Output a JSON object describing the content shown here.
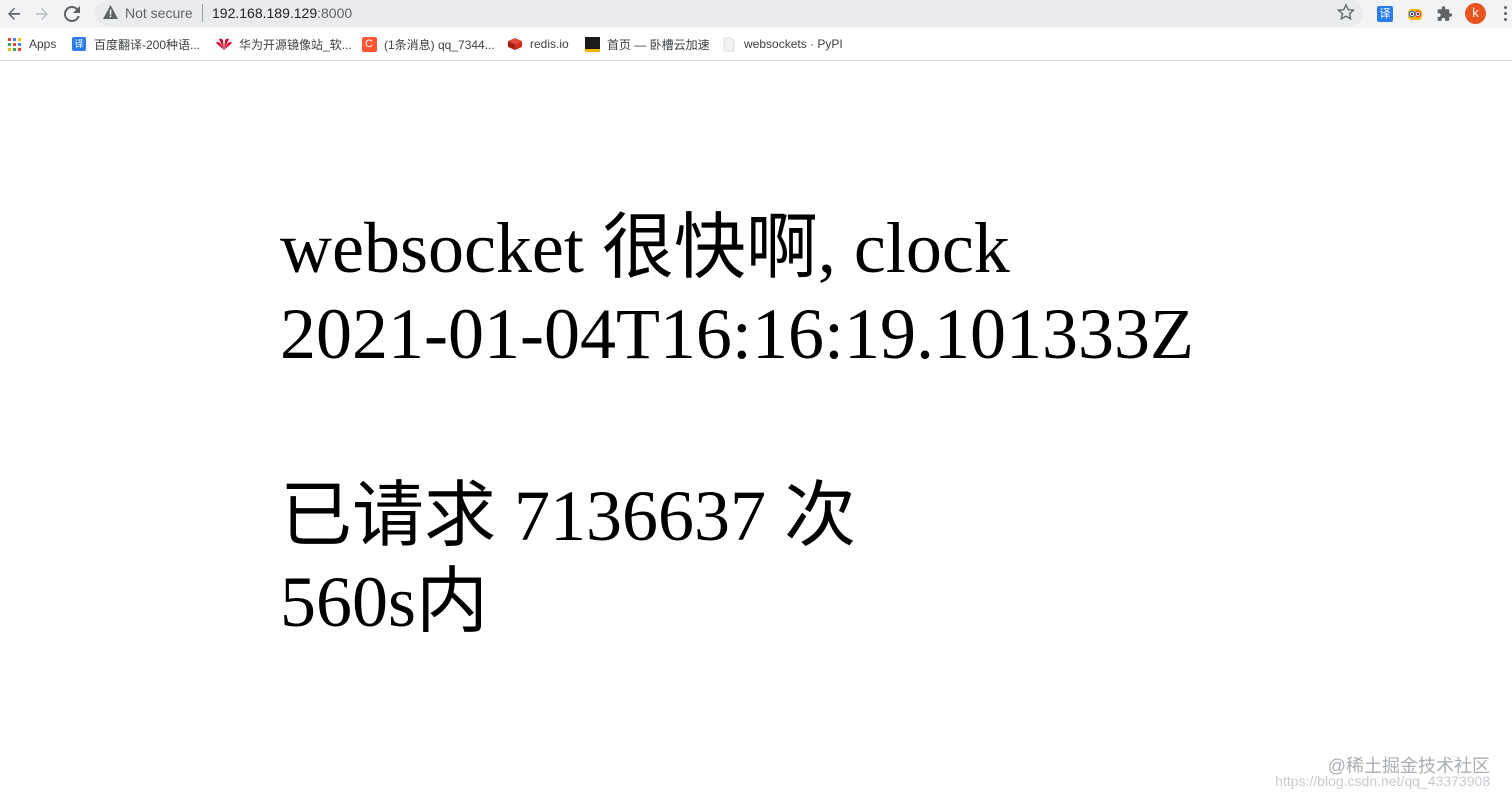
{
  "browser": {
    "address_bar": {
      "security_label": "Not secure",
      "host": "192.168.189.129",
      "port": ":8000"
    },
    "profile_initial": "k",
    "translate_ext_label": "译",
    "bookmarks": [
      {
        "label": "Apps",
        "icon": "apps-grid-icon",
        "color": "#4285f4"
      },
      {
        "label": "百度翻译-200种语...",
        "icon": "baidu-translate-icon",
        "color": "#2b7de9"
      },
      {
        "label": "华为开源镜像站_软...",
        "icon": "huawei-icon",
        "color": "#cf0a2c"
      },
      {
        "label": "(1条消息) qq_7344...",
        "icon": "csdn-icon",
        "color": "#fc5531"
      },
      {
        "label": "redis.io",
        "icon": "redis-icon",
        "color": "#d82c20"
      },
      {
        "label": "首页 — 卧槽云加速",
        "icon": "woocao-icon",
        "color": "#1a1a1a"
      },
      {
        "label": "websockets · PyPI",
        "icon": "page-icon",
        "color": "#e0e0e0"
      }
    ]
  },
  "page": {
    "line1": "websocket 很快啊, clock",
    "line2": "2021-01-04T16:16:19.101333Z",
    "line3": "已请求 7136637 次",
    "line4": "560s内"
  },
  "watermark": {
    "text": "@稀土掘金技术社区",
    "url": "https://blog.csdn.net/qq_43373908"
  }
}
